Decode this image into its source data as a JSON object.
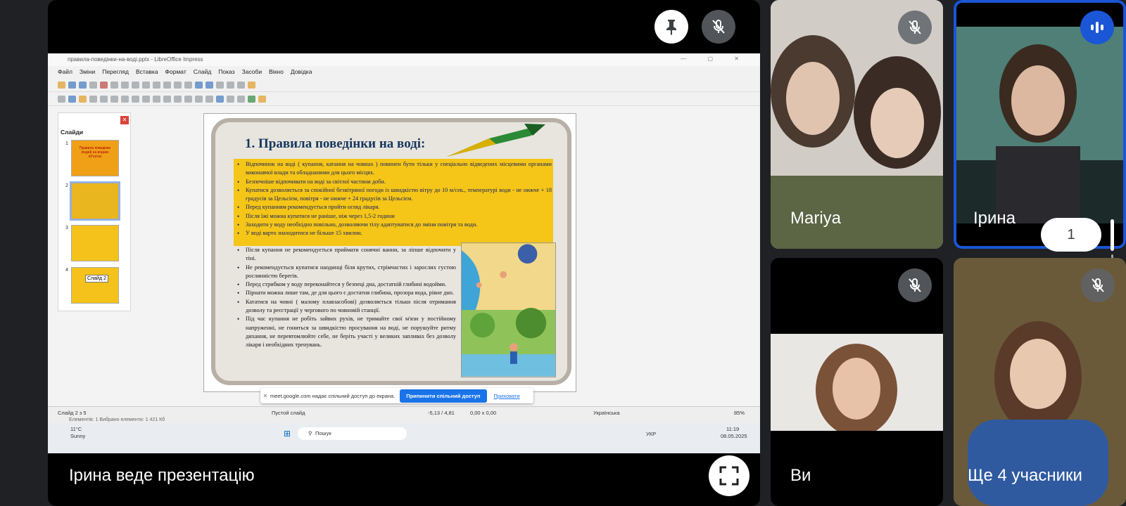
{
  "main": {
    "presenter_label": "Ірина веде презентацію",
    "pin_icon": "pin-icon",
    "mic_icon": "mic-off-icon",
    "fullscreen_icon": "fullscreen-icon"
  },
  "libreoffice": {
    "window_title": "правила-поведінки-на-воді.pptx - LibreOffice Impress",
    "menu": [
      "Файл",
      "Зміни",
      "Перегляд",
      "Вставка",
      "Формат",
      "Слайд",
      "Показ",
      "Засоби",
      "Вікно",
      "Довідка"
    ],
    "panel_title": "Слайди",
    "thumbnails": [
      "1",
      "2",
      "3",
      "4"
    ],
    "thumb1_text": "Правила поведінки людей на водних об'єктах",
    "thumb_tooltip": "Слайд 2",
    "slide": {
      "title": "1. Правила поведінки на воді:",
      "yellow_rules": [
        "Відпочинок на воді ( купання, катання на човнах ) повинен бути тільки у спеціально відведених місцевими органами виконавчої влади та обладнаними для цього місцях.",
        "Безпечніше відпочивати на воді за світлої частини доби.",
        "Купатися дозволяється за спокійної безвітряної погоди із швидкістю вітру до 10 м/сек., температурі води - не нижче + 18 градусів за Цельсієм, повітря - не нижче + 24 градусів за Цельсієм.",
        "Перед купанням рекомендується пройти огляд лікаря.",
        "Після їжі можна купатися не раніше, ніж через 1,5-2 години",
        "Заходити у воду необхідно повільно, дозволяючи тілу адаптуватися до зміни повітря та води.",
        "У воді варто знаходитися не більше 15 хвилин."
      ],
      "lower_rules": [
        "Після купання не рекомендується приймати сонячні ванни, за ліпше відпочити у тіні.",
        "Не рекомендується купатися наодинці біля крутих, стрімчастих і зарослих густою рослинністю берегів.",
        "Перед стрибком у воду переконайтеся у безпеці дна, достатній глибині водойми.",
        "Пірнати можна лише там, де для цього є достатня глибина, прозора вода, рівне дно.",
        "Кататися на човні ( малому плавзасобові) дозволяється тільки після отримання дозволу та реєстрації у чергового по човновій станції.",
        "Під час купання не робіть зайвих рухів, не тримайте свої м'язи у постійному напруженні, не гониться за швидкістю просування на воді, не порушуйте ритму дихання, не перевтомлюйте себе, не беріть участі у великих запливах без дозволу лікаря і необхідних тренувань."
      ]
    },
    "share_bar": {
      "text": "meet.google.com надає спільний доступ до екрана.",
      "stop_label": "Припинити спільний доступ",
      "hide_label": "Приховати"
    },
    "status": {
      "slide_counter": "Слайд 2 з 5",
      "layout": "Пустой слайд",
      "coords": "-5,13 / 4,81",
      "size": "0,00 x 0,00",
      "language": "Українська",
      "zoom": "85%",
      "selection": "Елементів: 1    Вибрано елементи: 1    421 Кб"
    },
    "taskbar": {
      "weather_temp": "11°C",
      "weather_desc": "Sunny",
      "search": "Пошук",
      "lang": "УКР",
      "time": "11:19",
      "date": "08.05.2025"
    }
  },
  "participants": [
    {
      "name": "Mariya",
      "mic": "mic-off-icon"
    },
    {
      "name": "Ірина",
      "status": "speaking-icon"
    },
    {
      "name": "Ви",
      "mic": "mic-off-icon"
    },
    {
      "name": "Ще 4 учасники",
      "mic": "mic-off-icon"
    }
  ],
  "raise_count": "1",
  "colors": {
    "background": "#202124",
    "speaking_ring": "#1a56d6",
    "share_button": "#1a73e8",
    "slide_yellow": "#f5c518"
  }
}
